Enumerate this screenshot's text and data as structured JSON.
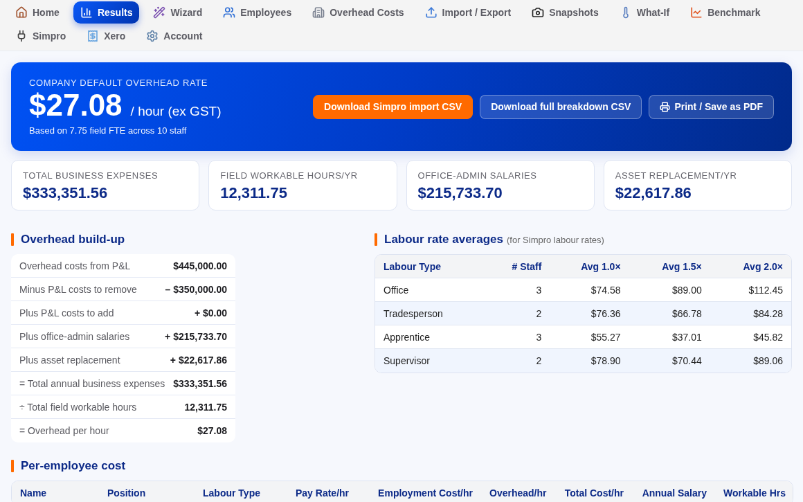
{
  "nav": {
    "items": [
      {
        "label": "Home",
        "selected": false
      },
      {
        "label": "Results",
        "selected": true
      },
      {
        "label": "Wizard",
        "selected": false
      },
      {
        "label": "Employees",
        "selected": false
      },
      {
        "label": "Overhead Costs",
        "selected": false
      },
      {
        "label": "Import / Export",
        "selected": false
      },
      {
        "label": "Snapshots",
        "selected": false
      },
      {
        "label": "What-If",
        "selected": false
      },
      {
        "label": "Benchmark",
        "selected": false
      },
      {
        "label": "Simpro",
        "selected": false
      },
      {
        "label": "Xero",
        "selected": false
      },
      {
        "label": "Account",
        "selected": false
      }
    ]
  },
  "hero": {
    "label": "COMPANY DEFAULT OVERHEAD RATE",
    "rate": "$27.08",
    "unit": "/ hour (ex GST)",
    "note": "Based on 7.75 field FTE across 10 staff",
    "buttons": [
      {
        "label": "Download Simpro import CSV",
        "kind": "primary"
      },
      {
        "label": "Download full breakdown CSV",
        "kind": "outline"
      },
      {
        "label": "Print / Save as PDF",
        "kind": "print"
      }
    ]
  },
  "stats": [
    {
      "label": "TOTAL BUSINESS EXPENSES",
      "value": "$333,351.56"
    },
    {
      "label": "FIELD WORKABLE HOURS/YR",
      "value": "12,311.75"
    },
    {
      "label": "OFFICE-ADMIN SALARIES",
      "value": "$215,733.70"
    },
    {
      "label": "ASSET REPLACEMENT/YR",
      "value": "$22,617.86"
    }
  ],
  "overhead_buildup": {
    "title": "Overhead build-up",
    "rows": [
      {
        "label": "Overhead costs from P&L",
        "value": "$445,000.00"
      },
      {
        "label": "Minus P&L costs to remove",
        "value": "– $350,000.00"
      },
      {
        "label": "Plus P&L costs to add",
        "value": "+ $0.00"
      },
      {
        "label": "Plus office-admin salaries",
        "value": "+ $215,733.70"
      },
      {
        "label": "Plus asset replacement",
        "value": "+ $22,617.86"
      },
      {
        "label": "= Total annual business expenses",
        "value": "$333,351.56"
      },
      {
        "label": "÷ Total field workable hours",
        "value": "12,311.75"
      },
      {
        "label": "= Overhead per hour",
        "value": "$27.08"
      }
    ]
  },
  "labour_rates": {
    "title": "Labour rate averages",
    "subtitle": "(for Simpro labour rates)",
    "columns": [
      "Labour Type",
      "# Staff",
      "Avg 1.0×",
      "Avg 1.5×",
      "Avg 2.0×"
    ],
    "rows": [
      [
        "Office",
        "3",
        "$74.58",
        "$89.00",
        "$112.45"
      ],
      [
        "Tradesperson",
        "2",
        "$76.36",
        "$66.78",
        "$84.28"
      ],
      [
        "Apprentice",
        "3",
        "$55.27",
        "$37.01",
        "$45.82"
      ],
      [
        "Supervisor",
        "2",
        "$78.90",
        "$70.44",
        "$89.06"
      ]
    ]
  },
  "per_employee": {
    "title": "Per-employee cost",
    "columns": [
      "Name",
      "Position",
      "Labour Type",
      "Pay Rate/hr",
      "Employment Cost/hr",
      "Overhead/hr",
      "Total Cost/hr",
      "Annual Salary",
      "Workable Hrs"
    ]
  }
}
